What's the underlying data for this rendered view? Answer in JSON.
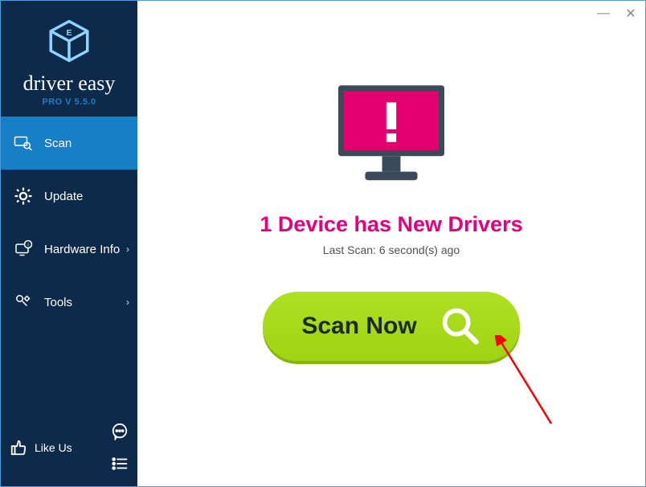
{
  "brand": {
    "wordmark": "driver easy",
    "tagline": "PRO V 5.5.0"
  },
  "sidebar": {
    "items": [
      {
        "id": "scan",
        "label": "Scan",
        "chevron": false,
        "active": true
      },
      {
        "id": "update",
        "label": "Update",
        "chevron": false,
        "active": false
      },
      {
        "id": "hwinfo",
        "label": "Hardware Info",
        "chevron": true,
        "active": false
      },
      {
        "id": "tools",
        "label": "Tools",
        "chevron": true,
        "active": false
      }
    ]
  },
  "footer": {
    "like_label": "Like Us"
  },
  "window": {
    "minimize": "—",
    "close": "✕"
  },
  "main": {
    "headline": "1 Device has New Drivers",
    "subline": "Last Scan: 6 second(s) ago",
    "scan_label": "Scan Now"
  },
  "colors": {
    "sidebar_bg": "#0d2a4a",
    "sidebar_active": "#167fc6",
    "accent_pink": "#e4007f",
    "scan_green": "#9ed411"
  }
}
